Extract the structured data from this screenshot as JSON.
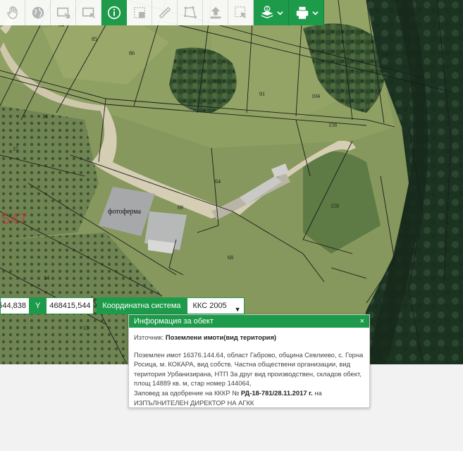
{
  "toolbar": {
    "buttons": [
      {
        "icon": "hand-pan-icon"
      },
      {
        "icon": "globe-icon"
      },
      {
        "icon": "zoom-in-rect-icon"
      },
      {
        "icon": "zoom-out-rect-icon"
      },
      {
        "icon": "info-icon",
        "active": true
      },
      {
        "icon": "area-measure-icon"
      },
      {
        "icon": "ruler-icon"
      },
      {
        "icon": "polygon-icon"
      },
      {
        "icon": "upload-icon"
      },
      {
        "icon": "select-rect-icon"
      },
      {
        "icon": "layers-info-icon"
      },
      {
        "icon": "print-icon"
      }
    ],
    "accent_color": "#1d9b4a"
  },
  "map": {
    "parcel_numbers": [
      "84",
      "85",
      "86",
      "88",
      "89",
      "91",
      "104",
      "158",
      "138",
      "14",
      "15",
      "64",
      "69",
      "68",
      "159",
      "14",
      "13"
    ],
    "place_label": "фотоферма",
    "red_label": "547"
  },
  "coords": {
    "x_value": "544,838",
    "y_label": "Y",
    "y_value": "468415,544",
    "system_label": "Координатна система",
    "system_value": "ККС 2005"
  },
  "popup": {
    "title": "Информация за обект",
    "close": "×",
    "source_label": "Източник:",
    "source_value": "Поземлени имоти(вид територия)",
    "line1": "Поземлен имот 16376.144.64, област Габрово, община Севлиево, с. Горна",
    "line2": "Росица, м. КОКАРА, вид собств. Частна обществени организации, вид",
    "line3": "територия Урбанизирана, НТП За друг вид производствен, складов обект,",
    "line4": "площ 14889 кв. м, стар номер 144064,",
    "line5_prefix": "Заповед за одобрение на КККР №",
    "line5_order": "РД-18-781/28.11.2017 г.",
    "line5_suffix": "на",
    "line6": "ИЗПЪЛНИТЕЛЕН ДИРЕКТОР НА АГКК"
  }
}
